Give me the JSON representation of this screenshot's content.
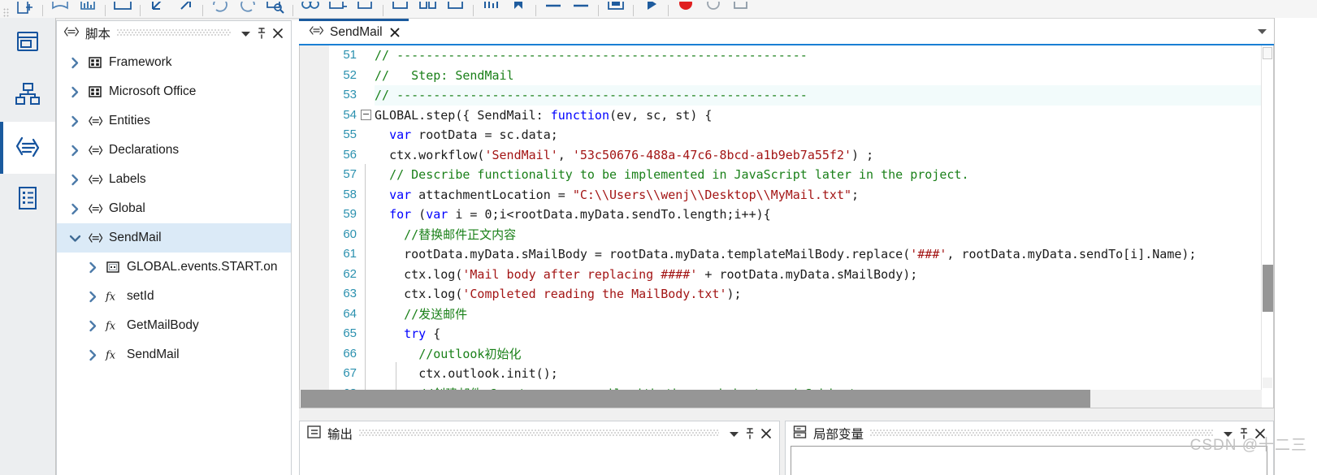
{
  "toolbar": {
    "icons": [
      "new-document-icon",
      "chart-icon",
      "database-icon",
      "window-icon",
      "undo-arrow-icon",
      "redo-arrow-icon",
      "rotate-left-icon",
      "rotate-right-icon",
      "zoom-find-icon",
      "link-icon",
      "copy-window-icon",
      "paste-window-icon",
      "panel-icon",
      "panels-split-icon",
      "panel-bottom-icon",
      "chart-bar-icon",
      "bookmark-icon",
      "minus-icon",
      "minus-alt-icon",
      "screen-icon",
      "run-play-icon",
      "record-stop-icon",
      "circle-icon",
      "list-icon"
    ]
  },
  "activitybar": {
    "items": [
      {
        "name": "window-icon",
        "label": "Window",
        "active": false
      },
      {
        "name": "hierarchy-icon",
        "label": "Hierarchy",
        "active": false
      },
      {
        "name": "script-icon",
        "label": "Script",
        "active": true
      },
      {
        "name": "list-document-icon",
        "label": "List",
        "active": false
      }
    ]
  },
  "tree_panel": {
    "title": "脚本",
    "header_buttons": [
      {
        "name": "chevron-down-icon",
        "label": "▾"
      },
      {
        "name": "pin-icon",
        "label": "Pin"
      },
      {
        "name": "close-icon",
        "label": "Close"
      }
    ],
    "items": [
      {
        "label": "Framework",
        "icon": "module-grid-icon",
        "depth": 0,
        "expanded": false,
        "selected": false
      },
      {
        "label": "Microsoft Office",
        "icon": "module-grid-icon",
        "depth": 0,
        "expanded": false,
        "selected": false
      },
      {
        "label": "Entities",
        "icon": "script-icon",
        "depth": 0,
        "expanded": false,
        "selected": false
      },
      {
        "label": "Declarations",
        "icon": "script-icon",
        "depth": 0,
        "expanded": false,
        "selected": false
      },
      {
        "label": "Labels",
        "icon": "script-icon",
        "depth": 0,
        "expanded": false,
        "selected": false
      },
      {
        "label": "Global",
        "icon": "script-icon",
        "depth": 0,
        "expanded": false,
        "selected": false
      },
      {
        "label": "SendMail",
        "icon": "script-icon",
        "depth": 0,
        "expanded": true,
        "selected": true
      },
      {
        "label": "GLOBAL.events.START.on",
        "icon": "event-block-icon",
        "depth": 1,
        "expanded": false,
        "selected": false
      },
      {
        "label": "setId",
        "icon": "function-icon",
        "depth": 1,
        "expanded": false,
        "selected": false
      },
      {
        "label": "GetMailBody",
        "icon": "function-icon",
        "depth": 1,
        "expanded": false,
        "selected": false
      },
      {
        "label": "SendMail",
        "icon": "function-icon",
        "depth": 1,
        "expanded": false,
        "selected": false
      }
    ]
  },
  "editor": {
    "tab": {
      "label": "SendMail",
      "icon": "script-icon",
      "close": "✕",
      "active": true
    },
    "overflow_chevron": "▾",
    "first_line_number": 51,
    "lines": [
      {
        "n": 51,
        "indent": 0,
        "fold": false,
        "highlight": false,
        "tokens": [
          {
            "t": "cmt",
            "v": "// --------------------------------------------------------"
          }
        ]
      },
      {
        "n": 52,
        "indent": 0,
        "fold": false,
        "highlight": false,
        "tokens": [
          {
            "t": "cmt",
            "v": "//   Step: SendMail"
          }
        ]
      },
      {
        "n": 53,
        "indent": 0,
        "fold": false,
        "highlight": true,
        "tokens": [
          {
            "t": "cmt",
            "v": "// --------------------------------------------------------"
          }
        ]
      },
      {
        "n": 54,
        "indent": 0,
        "fold": true,
        "highlight": false,
        "tokens": [
          {
            "t": "plain",
            "v": "GLOBAL.step({ SendMail: "
          },
          {
            "t": "kw",
            "v": "function"
          },
          {
            "t": "plain",
            "v": "(ev, sc, st) {"
          }
        ]
      },
      {
        "n": 55,
        "indent": 1,
        "fold": false,
        "highlight": false,
        "tokens": [
          {
            "t": "kw",
            "v": "var"
          },
          {
            "t": "plain",
            "v": " rootData = sc.data;"
          }
        ]
      },
      {
        "n": 56,
        "indent": 1,
        "fold": false,
        "highlight": false,
        "tokens": [
          {
            "t": "plain",
            "v": "ctx.workflow("
          },
          {
            "t": "str",
            "v": "'SendMail'"
          },
          {
            "t": "plain",
            "v": ", "
          },
          {
            "t": "str",
            "v": "'53c50676-488a-47c6-8bcd-a1b9eb7a55f2'"
          },
          {
            "t": "plain",
            "v": ") ;"
          }
        ]
      },
      {
        "n": 57,
        "indent": 1,
        "fold": false,
        "highlight": false,
        "tokens": [
          {
            "t": "cmt",
            "v": "// Describe functionality to be implemented in JavaScript later in the project."
          }
        ]
      },
      {
        "n": 58,
        "indent": 1,
        "fold": false,
        "highlight": false,
        "tokens": [
          {
            "t": "kw",
            "v": "var"
          },
          {
            "t": "plain",
            "v": " attachmentLocation = "
          },
          {
            "t": "str",
            "v": "\"C:\\\\Users\\\\wenj\\\\Desktop\\\\MyMail.txt\""
          },
          {
            "t": "plain",
            "v": ";"
          }
        ]
      },
      {
        "n": 59,
        "indent": 1,
        "fold": false,
        "highlight": false,
        "tokens": [
          {
            "t": "kw",
            "v": "for"
          },
          {
            "t": "plain",
            "v": " ("
          },
          {
            "t": "kw",
            "v": "var"
          },
          {
            "t": "plain",
            "v": " i = 0;i<rootData.myData.sendTo.length;i++){"
          }
        ]
      },
      {
        "n": 60,
        "indent": 2,
        "fold": false,
        "highlight": false,
        "tokens": [
          {
            "t": "cmt",
            "v": "//替换邮件正文内容"
          }
        ]
      },
      {
        "n": 61,
        "indent": 2,
        "fold": false,
        "highlight": false,
        "tokens": [
          {
            "t": "plain",
            "v": "rootData.myData.sMailBody = rootData.myData.templateMailBody.replace("
          },
          {
            "t": "str",
            "v": "'###'"
          },
          {
            "t": "plain",
            "v": ", rootData.myData.sendTo[i].Name);"
          }
        ]
      },
      {
        "n": 62,
        "indent": 2,
        "fold": false,
        "highlight": false,
        "tokens": [
          {
            "t": "plain",
            "v": "ctx.log("
          },
          {
            "t": "str",
            "v": "'Mail body after replacing ####'"
          },
          {
            "t": "plain",
            "v": " + rootData.myData.sMailBody);"
          }
        ]
      },
      {
        "n": 63,
        "indent": 2,
        "fold": false,
        "highlight": false,
        "tokens": [
          {
            "t": "plain",
            "v": "ctx.log("
          },
          {
            "t": "str",
            "v": "'Completed reading the MailBody.txt'"
          },
          {
            "t": "plain",
            "v": ");"
          }
        ]
      },
      {
        "n": 64,
        "indent": 2,
        "fold": false,
        "highlight": false,
        "tokens": [
          {
            "t": "cmt",
            "v": "//发送邮件"
          }
        ]
      },
      {
        "n": 65,
        "indent": 2,
        "fold": false,
        "highlight": false,
        "tokens": [
          {
            "t": "kw",
            "v": "try"
          },
          {
            "t": "plain",
            "v": " {"
          }
        ]
      },
      {
        "n": 66,
        "indent": 3,
        "fold": false,
        "highlight": false,
        "tokens": [
          {
            "t": "cmt",
            "v": "//outlook初始化"
          }
        ]
      },
      {
        "n": 67,
        "indent": 3,
        "fold": false,
        "highlight": false,
        "tokens": [
          {
            "t": "plain",
            "v": "ctx.outlook.init();"
          }
        ]
      },
      {
        "n": 68,
        "indent": 3,
        "fold": false,
        "highlight": false,
        "tokens": [
          {
            "t": "cmt",
            "v": "//创建邮件 Creates a new mail with the recipients and Subject."
          }
        ]
      }
    ]
  },
  "output_panel": {
    "title": "输出",
    "icon": "output-icon",
    "header_buttons": [
      {
        "name": "chevron-down-icon",
        "label": "▾"
      },
      {
        "name": "pin-icon",
        "label": "Pin"
      },
      {
        "name": "close-icon",
        "label": "Close"
      }
    ],
    "content": ""
  },
  "locals_panel": {
    "title": "局部变量",
    "icon": "locals-icon",
    "header_buttons": [
      {
        "name": "chevron-down-icon",
        "label": "▾"
      },
      {
        "name": "pin-icon",
        "label": "Pin"
      },
      {
        "name": "close-icon",
        "label": "Close"
      }
    ],
    "content": ""
  },
  "watermark": {
    "text": "CSDN @十二三"
  },
  "colors": {
    "accent": "#1a7fd4",
    "tab_accent": "#1a5a9e",
    "selection": "#dbeaf7",
    "keyword": "#0000ff",
    "string": "#a31515",
    "comment": "#1a8019",
    "line_number": "#2b91af",
    "scrollbar_thumb": "#969696",
    "panel_border": "#ccd0d4"
  }
}
